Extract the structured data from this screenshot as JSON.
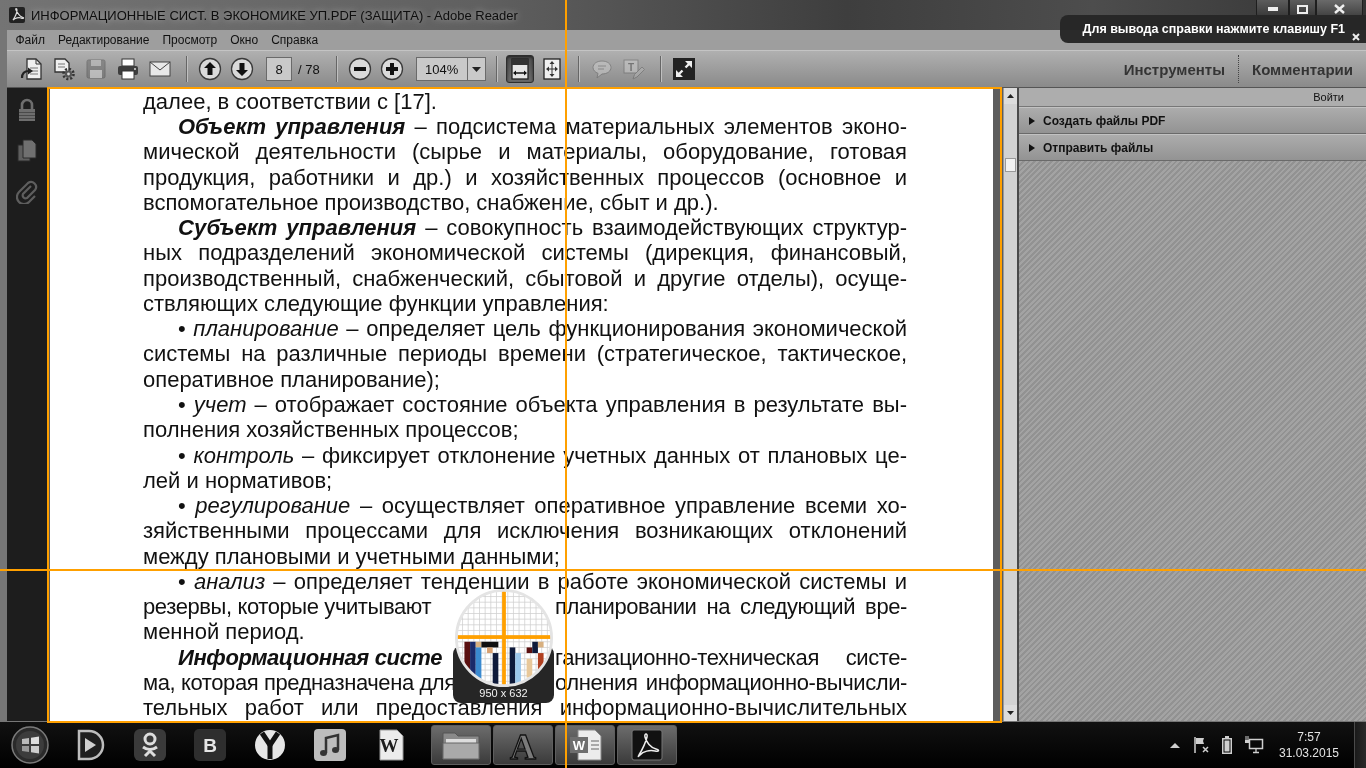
{
  "window": {
    "title": "ИНФОРМАЦИОННЫЕ СИСТ. В ЭКОНОМИКЕ УП.PDF (ЗАЩИТА) - Adobe Reader"
  },
  "tooltip": {
    "text": "Для вывода справки нажмите клавишу F1"
  },
  "menu": [
    {
      "label": "Файл"
    },
    {
      "label": "Редактирование"
    },
    {
      "label": "Просмотр"
    },
    {
      "label": "Окно"
    },
    {
      "label": "Справка"
    }
  ],
  "toolbar": {
    "groups": [
      [
        {
          "kind": "create",
          "disabled": false,
          "pressed": false
        },
        {
          "kind": "settings",
          "disabled": false,
          "pressed": false
        },
        {
          "kind": "save",
          "disabled": true,
          "pressed": false
        },
        {
          "kind": "print",
          "disabled": false,
          "pressed": false
        },
        {
          "kind": "email",
          "disabled": false,
          "pressed": false
        }
      ],
      [
        {
          "kind": "previous",
          "disabled": false,
          "pressed": false
        },
        {
          "kind": "next",
          "disabled": false,
          "pressed": false
        },
        {
          "kind": "page-field",
          "value": "8"
        },
        {
          "kind": "page-count",
          "text": "/ 78"
        }
      ],
      [
        {
          "kind": "zoom-out",
          "disabled": false,
          "pressed": false
        },
        {
          "kind": "zoom-in",
          "disabled": false,
          "pressed": false
        },
        {
          "kind": "zoom-field",
          "value": "104%"
        }
      ],
      [
        {
          "kind": "fit-width",
          "disabled": false,
          "pressed": true
        },
        {
          "kind": "fit-page",
          "disabled": false,
          "pressed": false
        }
      ],
      [
        {
          "kind": "comment",
          "disabled": true,
          "pressed": false
        },
        {
          "kind": "text-tool",
          "disabled": true,
          "pressed": false,
          "glyph": "T"
        }
      ],
      [
        {
          "kind": "full-screen",
          "disabled": false,
          "pressed": false
        }
      ]
    ],
    "panes": [
      {
        "label": "Инструменты"
      },
      {
        "label": "Комментарии"
      }
    ]
  },
  "document": {
    "paragraphs": [
      {
        "kind": "continuation",
        "continues": false,
        "lines": [
          [
            "далее, в соответствии с [17]."
          ]
        ]
      },
      {
        "kind": "definition",
        "continues": false,
        "lines": [
          [
            "*Объект управления* – подсистема материальных элементов эконо-"
          ],
          [
            "мической деятельности (сырье и материалы, оборудование, готовая"
          ],
          [
            "продукция, работники и др.) и хозяйственных процессов (основное и"
          ],
          [
            "вспомогательное производство, снабжение, сбыт и др.)."
          ]
        ]
      },
      {
        "kind": "definition",
        "continues": false,
        "lines": [
          [
            "*Субъект управления* – совокупность взаимодействующих структур-"
          ],
          [
            "ных подразделений экономической системы (дирекция, финансовый,"
          ],
          [
            "производственный, снабженческий, сбытовой и другие отделы), осуще-"
          ],
          [
            "ствляющих следующие функции управления:"
          ]
        ]
      },
      {
        "kind": "bullet",
        "continues": false,
        "lines": [
          [
            "• *планирование* – определяет цель функционирования экономической"
          ],
          [
            "системы на различные периоды времени (стратегическое, тактическое,"
          ],
          [
            "оперативное планирование);"
          ]
        ]
      },
      {
        "kind": "bullet",
        "continues": false,
        "lines": [
          [
            "• *учет* – отображает состояние объекта управления в результате вы-"
          ],
          [
            "полнения хозяйственных процессов;"
          ]
        ]
      },
      {
        "kind": "bullet",
        "continues": false,
        "lines": [
          [
            "• *контроль* – фиксирует отклонение учетных данных от плановых це-"
          ],
          [
            "лей и нормативов;"
          ]
        ]
      },
      {
        "kind": "bullet",
        "continues": false,
        "lines": [
          [
            "• *регулирование* – осуществляет оперативное управление всеми хо-"
          ],
          [
            "зяйственными процессами для исключения возникающих отклонений"
          ],
          [
            "между плановыми и учетными данными;"
          ]
        ]
      },
      {
        "kind": "bullet",
        "continues": false,
        "lines": [
          [
            "• *анализ* – определяет тенденции в работе экономической системы и"
          ],
          [
            "резервы, которые учитывают",
            "планировании на следующий вре-"
          ],
          [
            "менной период."
          ]
        ]
      },
      {
        "kind": "definition",
        "continues": true,
        "lines": [
          [
            "*Информационная систе*",
            "ганизационно-техническая систе-"
          ],
          [
            "ма, которая предназначена для",
            "олнения информационно-вычисли-"
          ],
          [
            "тельных работ или предоставления информационно-вычислительных"
          ]
        ]
      }
    ]
  },
  "right_pane": {
    "sign_in": "Войти",
    "sections": [
      {
        "label": "Создать файлы PDF",
        "expanded": false
      },
      {
        "label": "Отправить файлы",
        "expanded": false
      }
    ]
  },
  "taskbar": {
    "pinned": [
      {
        "kind": "player"
      },
      {
        "kind": "figure"
      },
      {
        "kind": "letter-tile",
        "glyph": "В"
      },
      {
        "kind": "ball"
      },
      {
        "kind": "music"
      },
      {
        "kind": "document",
        "glyph": "W"
      }
    ],
    "running": [
      {
        "kind": "folder"
      },
      {
        "kind": "letter",
        "glyph": "A"
      },
      {
        "kind": "document",
        "glyph": "W"
      },
      {
        "kind": "swirl"
      }
    ],
    "clock": {
      "time": "7:57",
      "date": "31.03.2015"
    }
  },
  "capture_overlay": {
    "size_label": "950 x 632"
  }
}
